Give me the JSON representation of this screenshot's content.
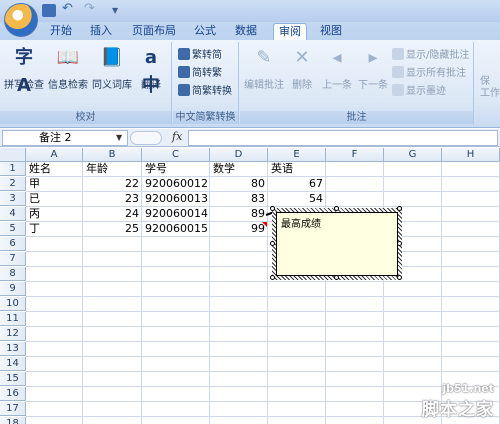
{
  "quick_access": {
    "save": "save-icon",
    "undo": "undo-icon",
    "redo": "redo-icon"
  },
  "tabs": [
    "开始",
    "插入",
    "页面布局",
    "公式",
    "数据",
    "审阅",
    "视图"
  ],
  "active_tab": "审阅",
  "ribbon": {
    "proofing": {
      "label": "校对",
      "buttons": [
        "拼写检查",
        "信息检索",
        "同义词库",
        "翻译"
      ]
    },
    "chinese_conversion": {
      "label": "中文简繁转换",
      "buttons": [
        "繁转简",
        "简转繁",
        "简繁转换"
      ]
    },
    "comments": {
      "label": "批注",
      "big_buttons": [
        "编辑批注",
        "删除",
        "上一条",
        "下一条"
      ],
      "small_buttons": [
        "显示/隐藏批注",
        "显示所有批注",
        "显示墨迹"
      ]
    },
    "protect_partial": [
      "保",
      "工作"
    ]
  },
  "formula_bar": {
    "name_box": "备注 2",
    "fx": "fx",
    "formula": ""
  },
  "columns": [
    "A",
    "B",
    "C",
    "D",
    "E",
    "F",
    "G",
    "H"
  ],
  "rows": [
    "1",
    "2",
    "3",
    "4",
    "5",
    "6",
    "7",
    "8",
    "9",
    "10",
    "11",
    "12",
    "13",
    "14",
    "15",
    "16",
    "17",
    "18"
  ],
  "cells": {
    "A1": "姓名",
    "B1": "年龄",
    "C1": "学号",
    "D1": "数学",
    "E1": "英语",
    "A2": "甲",
    "B2": "22",
    "C2": "920060012",
    "D2": "80",
    "E2": "67",
    "A3": "已",
    "B3": "23",
    "C3": "920060013",
    "D3": "83",
    "E3": "54",
    "A4": "丙",
    "B4": "24",
    "C4": "920060014",
    "D4": "89",
    "A5": "丁",
    "B5": "25",
    "C5": "920060015",
    "D5": "99"
  },
  "comment": {
    "text": "最高成绩",
    "cell": "D5"
  },
  "watermark": {
    "url": "jb51.net",
    "name": "脚本之家"
  }
}
